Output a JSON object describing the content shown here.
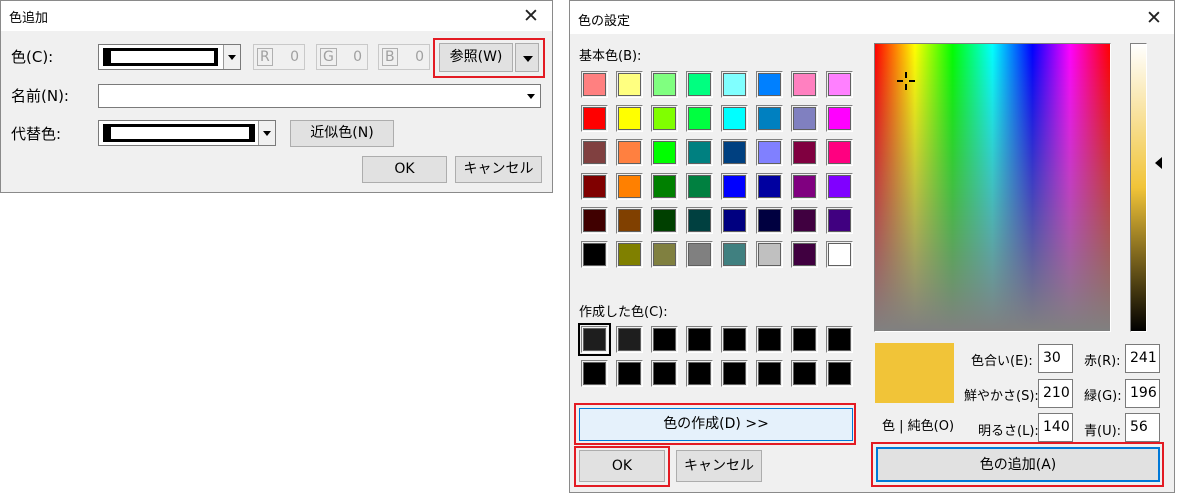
{
  "add_dialog": {
    "title": "色追加",
    "color_label": "色(C):",
    "r_label": "R",
    "r_value": "0",
    "g_label": "G",
    "g_value": "0",
    "b_label": "B",
    "b_value": "0",
    "browse_button": "参照(W)",
    "name_label": "名前(N):",
    "name_value": "",
    "alt_label": "代替色:",
    "approx_button": "近似色(N)",
    "ok": "OK",
    "cancel": "キャンセル"
  },
  "color_dialog": {
    "title": "色の設定",
    "basic_label": "基本色(B):",
    "basic_colors": [
      "#ff8080",
      "#ffff80",
      "#80ff80",
      "#00ff80",
      "#80ffff",
      "#0080ff",
      "#ff80c0",
      "#ff80ff",
      "#ff0000",
      "#ffff00",
      "#80ff00",
      "#00ff40",
      "#00ffff",
      "#0080c0",
      "#8080c0",
      "#ff00ff",
      "#804040",
      "#ff8040",
      "#00ff00",
      "#008080",
      "#004080",
      "#8080ff",
      "#800040",
      "#ff0080",
      "#800000",
      "#ff8000",
      "#008000",
      "#008040",
      "#0000ff",
      "#0000a0",
      "#800080",
      "#8000ff",
      "#400000",
      "#804000",
      "#004000",
      "#004040",
      "#000080",
      "#000040",
      "#400040",
      "#400080",
      "#000000",
      "#808000",
      "#808040",
      "#808080",
      "#408080",
      "#c0c0c0",
      "#400040",
      "#ffffff"
    ],
    "custom_label": "作成した色(C):",
    "custom_colors": [
      "#1e1e1e",
      "#1e1e1e",
      "#000000",
      "#000000",
      "#000000",
      "#000000",
      "#000000",
      "#000000",
      "#000000",
      "#000000",
      "#000000",
      "#000000",
      "#000000",
      "#000000",
      "#000000",
      "#000000"
    ],
    "define_button": "色の作成(D) >>",
    "ok": "OK",
    "cancel": "キャンセル",
    "color_solid_label": "色 | 純色(O)",
    "preview_color": "#f1c438",
    "hue_label": "色合い(E):",
    "hue": "30",
    "sat_label": "鮮やかさ(S):",
    "sat": "210",
    "lum_label": "明るさ(L):",
    "lum": "140",
    "red_label": "赤(R):",
    "red": "241",
    "green_label": "緑(G):",
    "green": "196",
    "blue_label": "青(U):",
    "blue": "56",
    "add_button": "色の追加(A)"
  },
  "colors": {
    "highlight": "#e31b23",
    "button_face": "#e1e1e1",
    "window_bg": "#f0f0f0"
  }
}
